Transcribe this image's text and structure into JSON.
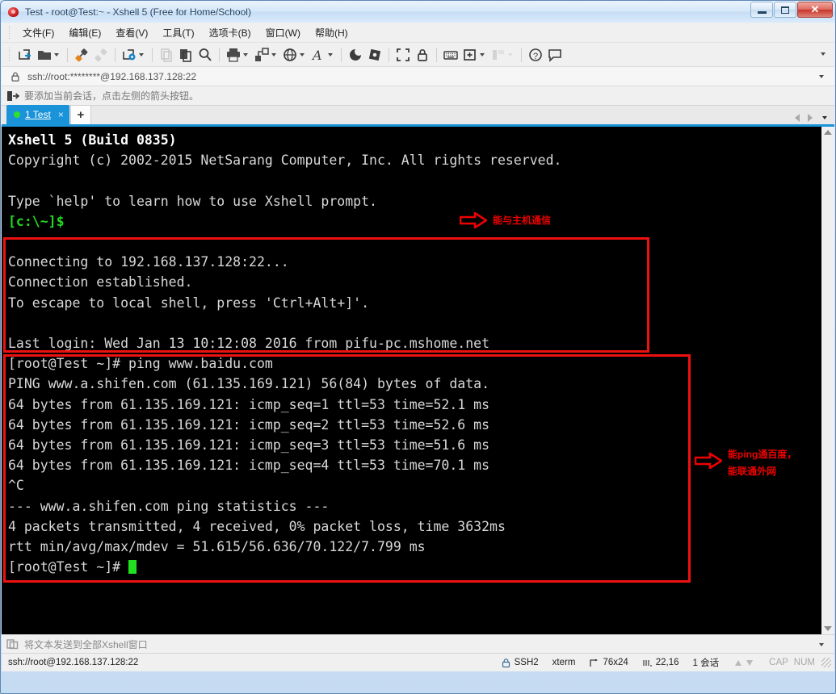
{
  "window": {
    "title": "Test - root@Test:~ - Xshell 5 (Free for Home/School)",
    "icon": "xshell-swirl-icon",
    "minimize_label": "",
    "maximize_label": "",
    "close_label": "✕"
  },
  "menubar": {
    "items": [
      {
        "label": "文件(F)",
        "name": "menu-file"
      },
      {
        "label": "编辑(E)",
        "name": "menu-edit"
      },
      {
        "label": "查看(V)",
        "name": "menu-view"
      },
      {
        "label": "工具(T)",
        "name": "menu-tools"
      },
      {
        "label": "选项卡(B)",
        "name": "menu-tabs"
      },
      {
        "label": "窗口(W)",
        "name": "menu-window"
      },
      {
        "label": "帮助(H)",
        "name": "menu-help"
      }
    ]
  },
  "toolbar": {
    "icons": [
      "new-session-icon",
      "open-folder-icon",
      "connect-plug-icon",
      "disconnect-plug-icon",
      "session-properties-icon",
      "copy-icon",
      "paste-icon",
      "find-icon",
      "print-icon",
      "transfer-icon",
      "globe-icon",
      "font-icon",
      "log-icon",
      "trace-icon",
      "fullscreen-icon",
      "lock-icon",
      "keyboard-icon",
      "add-pane-icon",
      "layout-icon",
      "help-icon",
      "comment-icon"
    ]
  },
  "address_bar": {
    "icon": "lock-icon",
    "value": "ssh://root:********@192.168.137.128:22",
    "dropdown_icon": "chevron-down-icon"
  },
  "info_bar": {
    "icon": "add-session-arrow-icon",
    "text": "要添加当前会话，点击左侧的箭头按钮。"
  },
  "tabs": {
    "active": {
      "label": "1 Test",
      "status_dot": "#2ee02e",
      "close": "×"
    },
    "new_tab_label": "+",
    "nav_prev_icon": "triangle-left-icon",
    "nav_next_icon": "triangle-right-icon",
    "overflow_icon": "chevron-down-icon"
  },
  "terminal": {
    "lines": [
      {
        "text": "Xshell 5 (Build 0835)",
        "style": "bold"
      },
      {
        "text": "Copyright (c) 2002-2015 NetSarang Computer, Inc. All rights reserved.",
        "style": "normal"
      },
      {
        "text": "",
        "style": "normal"
      },
      {
        "text": "Type `help' to learn how to use Xshell prompt.",
        "style": "normal"
      },
      {
        "text": "[c:\\~]$",
        "style": "green"
      },
      {
        "text": "",
        "style": "normal"
      },
      {
        "text": "Connecting to 192.168.137.128:22...",
        "style": "normal"
      },
      {
        "text": "Connection established.",
        "style": "normal"
      },
      {
        "text": "To escape to local shell, press 'Ctrl+Alt+]'.",
        "style": "normal"
      },
      {
        "text": "",
        "style": "normal"
      },
      {
        "text": "Last login: Wed Jan 13 10:12:08 2016 from pifu-pc.mshome.net",
        "style": "normal"
      },
      {
        "text": "[root@Test ~]# ping www.baidu.com",
        "style": "normal"
      },
      {
        "text": "PING www.a.shifen.com (61.135.169.121) 56(84) bytes of data.",
        "style": "normal"
      },
      {
        "text": "64 bytes from 61.135.169.121: icmp_seq=1 ttl=53 time=52.1 ms",
        "style": "normal"
      },
      {
        "text": "64 bytes from 61.135.169.121: icmp_seq=2 ttl=53 time=52.6 ms",
        "style": "normal"
      },
      {
        "text": "64 bytes from 61.135.169.121: icmp_seq=3 ttl=53 time=51.6 ms",
        "style": "normal"
      },
      {
        "text": "64 bytes from 61.135.169.121: icmp_seq=4 ttl=53 time=70.1 ms",
        "style": "normal"
      },
      {
        "text": "^C",
        "style": "normal"
      },
      {
        "text": "--- www.a.shifen.com ping statistics ---",
        "style": "normal"
      },
      {
        "text": "4 packets transmitted, 4 received, 0% packet loss, time 3632ms",
        "style": "normal"
      },
      {
        "text": "rtt min/avg/max/mdev = 51.615/56.636/70.122/7.799 ms",
        "style": "normal"
      }
    ],
    "prompt": "[root@Test ~]# ",
    "cursor_color": "#20e020",
    "background": "#000000",
    "foreground": "#d8d8d8"
  },
  "annotations": {
    "color": "#ee0000",
    "items": [
      {
        "name": "annotation-host-comm",
        "text": "能与主机通信",
        "icon": "red-arrow-right-icon"
      },
      {
        "name": "annotation-ping-baidu-line1",
        "text": "能ping通百度，",
        "icon": "red-arrow-right-icon"
      },
      {
        "name": "annotation-ping-baidu-line2",
        "text": "能联通外网",
        "icon": ""
      }
    ]
  },
  "send_bar": {
    "icon": "send-to-all-icon",
    "text": "将文本发送到全部Xshell窗口",
    "dropdown_icon": "chevron-down-icon"
  },
  "status_bar": {
    "connection": "ssh://root@192.168.137.128:22",
    "protocol_icon": "lock-icon",
    "protocol": "SSH2",
    "terminal_type": "xterm",
    "size_icon": "resize-icon",
    "size": "76x24",
    "cursor_icon": "cursor-pos-icon",
    "cursor_pos": "22,16",
    "sessions": "1 会话",
    "up_icon": "arrow-up-icon",
    "down_icon": "arrow-down-icon",
    "caps": "CAP",
    "num": "NUM"
  }
}
